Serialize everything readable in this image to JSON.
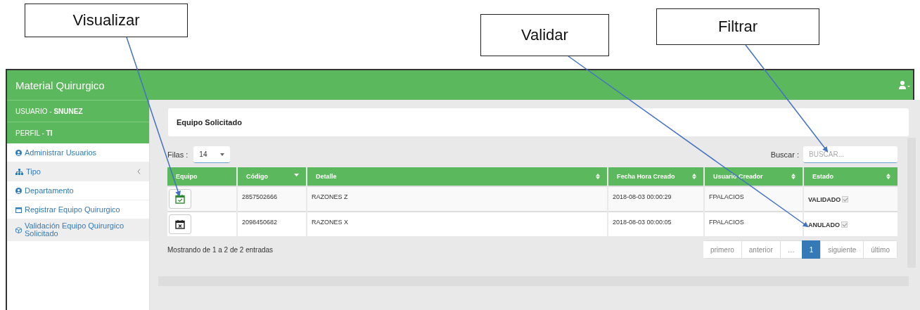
{
  "callouts": [
    {
      "label": "Visualizar"
    },
    {
      "label": "Validar"
    },
    {
      "label": "Filtrar"
    }
  ],
  "header": {
    "title": "Material Quirurgico"
  },
  "sidebar": {
    "user": "USUARIO - **SNUNEZ**",
    "profile": "PERFIL - **TI**",
    "items": [
      {
        "label": "Administrar Usuarios",
        "kind": "user",
        "expandable": false
      },
      {
        "label": "Tipo",
        "kind": "sitemap",
        "expandable": true
      },
      {
        "label": "Departamento",
        "kind": "user",
        "expandable": false
      },
      {
        "label": "Registrar Equipo Quirurgico",
        "kind": "calendar",
        "expandable": false
      },
      {
        "label": "Validación Equipo Quirurgico Solicitado",
        "kind": "cube",
        "expandable": false
      }
    ]
  },
  "panel": {
    "title": "Equipo Solicitado"
  },
  "rows_control": {
    "label": "Filas :",
    "value": "14"
  },
  "search": {
    "label": "Buscar :",
    "placeholder": "BUSCAR..."
  },
  "table": {
    "columns": [
      {
        "label": "Equipo",
        "kind": "plain"
      },
      {
        "label": "Código",
        "kind": "desc"
      },
      {
        "label": "Detalle",
        "kind": "both"
      },
      {
        "label": "Fecha Hora Creado",
        "kind": "both"
      },
      {
        "label": "Usuario Creador",
        "kind": "both"
      },
      {
        "label": "Estado",
        "kind": "both"
      }
    ],
    "rows": [
      {
        "kind": "validated",
        "codigo": "2857502666",
        "detalle": "RAZONES Z",
        "fecha": "2018-08-03 00:00:29",
        "usuario": "FPALACIOS",
        "estado": "VALIDADO",
        "checked": true
      },
      {
        "kind": "cancelled",
        "codigo": "2098450682",
        "detalle": "RAZONES X",
        "fecha": "2018-08-03 00:00:05",
        "usuario": "FPALACIOS",
        "estado": "ANULADO",
        "checked": true
      }
    ]
  },
  "info": "Mostrando de 1 a 2 de 2 entradas",
  "pagination": [
    {
      "label": "primero",
      "selected": false
    },
    {
      "label": "anterior",
      "selected": false
    },
    {
      "label": "…",
      "selected": false
    },
    {
      "label": "1",
      "selected": true
    },
    {
      "label": "siguiente",
      "selected": false
    },
    {
      "label": "último",
      "selected": false
    }
  ]
}
